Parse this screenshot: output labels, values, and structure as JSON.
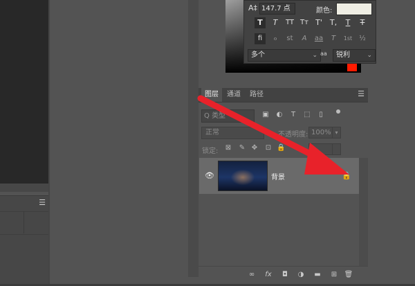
{
  "character_panel": {
    "size_value": "147.7 点",
    "color_label": "颜色:",
    "type_buttons": [
      "T",
      "T",
      "TT",
      "Tт",
      "T'",
      "T,",
      "T",
      "T"
    ],
    "opentype_buttons": [
      "fi",
      "ℴ",
      "st",
      "A",
      "aa",
      "T",
      "1st",
      "½"
    ],
    "language": "多个",
    "antialias_icon": "aa",
    "antialias": "锐利",
    "chevron": "⌄",
    "colors": {
      "text_color": "#efeee4"
    }
  },
  "layers_panel": {
    "tabs": [
      {
        "label": "图层"
      },
      {
        "label": "通道"
      },
      {
        "label": "路径"
      }
    ],
    "menu_icon": "☰",
    "filter": {
      "placeholder": "类型",
      "search_glyph": "Q",
      "icons": [
        "▣",
        "◐",
        "T",
        "⬚",
        "▯"
      ]
    },
    "blend_mode": "正常",
    "opacity_label": "不透明度:",
    "opacity_value": "100%",
    "lock_label": "锁定:",
    "lock_icons": [
      "⊠",
      "✎",
      "✥",
      "⊡",
      "🔒"
    ],
    "layers": [
      {
        "name": "背景",
        "visible": true,
        "locked": true
      }
    ],
    "bottom_icons": [
      "∞",
      "fx",
      "◘",
      "◑",
      "▬",
      "⊞",
      "🗑"
    ]
  },
  "left_panel": {
    "menu_icon": "☰"
  },
  "colors": {
    "accent_red": "#e8222a",
    "foreground_swatch": "#ff1b00"
  }
}
